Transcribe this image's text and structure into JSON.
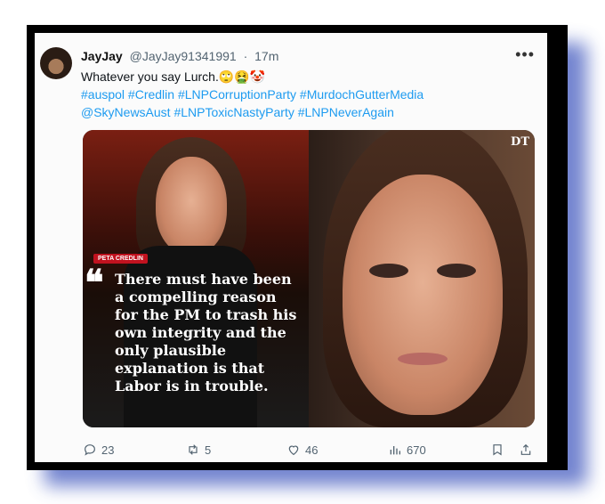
{
  "tweet": {
    "display_name": "JayJay",
    "handle": "@JayJay91341991",
    "separator": "·",
    "time": "17m",
    "more_icon": "ellipsis-icon",
    "body": "Whatever you say Lurch.",
    "emojis": "🙄🤮🤡",
    "hashtags_line1": "#auspol #Credlin #LNPCorruptionParty #MurdochGutterMedia",
    "hashtags_line2": "@SkyNewsAust #LNPToxicNastyParty #LNPNeverAgain"
  },
  "media": {
    "logo": "DT",
    "name_badge": "PETA CREDLIN",
    "quote_mark": "❝",
    "quote": "There must have been a compelling reason for the PM to trash his own integrity and the only plausible explanation is that Labor is in trouble."
  },
  "actions": {
    "replies": "23",
    "retweets": "5",
    "likes": "46",
    "views": "670"
  },
  "colors": {
    "frame": "#000000",
    "shadow": "#5b6fc7",
    "link": "#1d9bf0",
    "badge": "#c1121f"
  }
}
